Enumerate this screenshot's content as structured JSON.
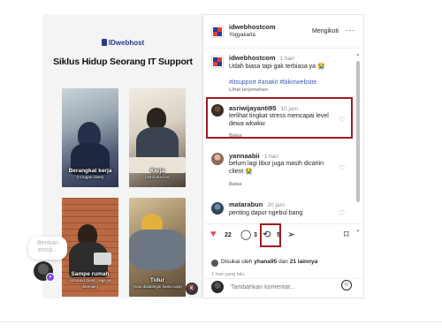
{
  "media": {
    "brand": "IDwebhost",
    "title": "Siklus Hidup Seorang IT Support",
    "photos": [
      {
        "caption": "Berangkat kerja",
        "sub": "(ni tugas client)"
      },
      {
        "caption": "Kerja",
        "sub": "(skrol skrol ni)"
      },
      {
        "caption": "Sampe rumah",
        "sub": "(inbound client ,\nsaja ya dikerjain)"
      },
      {
        "caption": "Tidur",
        "sub": "(mau didatangin hantu saja)"
      }
    ],
    "emoji_placeholder": "Berikan emoji..."
  },
  "post": {
    "account": "idwebhostcom",
    "location": "Yogyakarta",
    "follow_label": "Mengikuti",
    "more_label": "···",
    "caption_user": "idwebhostcom",
    "caption_time": "1 hari",
    "caption_text": "Udah biasa tapi gak terbiasa ya 😭",
    "hashtags": "#itsupport #anakit #bikinwebsite",
    "see_translation": "Lihat terjemahan",
    "comments": [
      {
        "user": "asriwijayanti95",
        "time": "10 jam",
        "text": "terlihat tingkat stress mencapai level dewa wkwkw",
        "reply": "Balas"
      },
      {
        "user": "yannaabii",
        "time": "1 hari",
        "text": "belum lagi libur juga masih dicariin client 😭",
        "reply": "Balas"
      },
      {
        "user": "matarabun",
        "time": "20 jam",
        "text": "penting dapur ngebul bang",
        "reply": ""
      }
    ],
    "likes_count": "22",
    "comments_count": "3",
    "reposts_count": "5",
    "liked_by_prefix": "Disukai oleh",
    "liked_by_user": "yhana95",
    "liked_by_joiner": "dan",
    "liked_by_rest": "21 lainnya",
    "posted_ago": "1 hari yang lalu",
    "comment_placeholder": "Tambahkan komentar..."
  },
  "colors": {
    "highlight": "#9e1b22",
    "like_red": "#ed4956",
    "hashtag_blue": "#3a5fb0",
    "brand_blue": "#2a3a8c"
  }
}
